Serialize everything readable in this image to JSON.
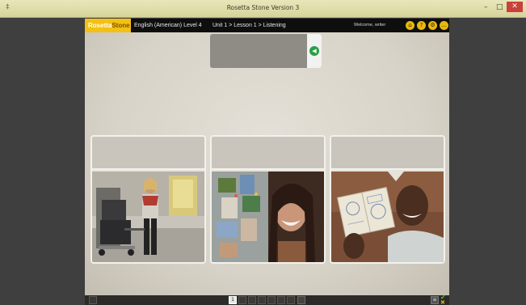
{
  "window": {
    "title": "Rosetta Stone Version 3",
    "app_icon_glyph": "‡",
    "minimize_glyph": "–",
    "maximize_glyph": "□",
    "close_glyph": "✕"
  },
  "header": {
    "logo_rosetta": "Rosetta",
    "logo_stone": "Stone",
    "course_level": "English (American) Level 4",
    "breadcrumb": "Unit 1 > Lesson 1 > Listening",
    "welcome": "Welcome, writer",
    "icons": [
      "home-icon",
      "help-icon",
      "settings-icon",
      "chat-icon"
    ],
    "icon_glyphs": {
      "home": "⌂",
      "help": "?",
      "settings": "⚙",
      "chat": "…"
    },
    "colors": {
      "brand_yellow": "#f3c014",
      "header_bg": "#0e0e0e"
    }
  },
  "prompt": {
    "audio_glyph": "◀",
    "colors": {
      "audio_button": "#28a046"
    }
  },
  "cards": [
    {
      "label": "",
      "image": "woman-with-luggage-cart-in-airport"
    },
    {
      "label": "",
      "image": "smiling-woman-next-to-fridge-with-photos"
    },
    {
      "label": "",
      "image": "smiling-man-holding-passport"
    }
  ],
  "footer": {
    "pages": [
      "1",
      "",
      "",
      "",
      "",
      "",
      ""
    ],
    "current_page": 1,
    "score_glyph": "≡",
    "correct_glyph": "✔",
    "incorrect_glyph": "✖"
  }
}
